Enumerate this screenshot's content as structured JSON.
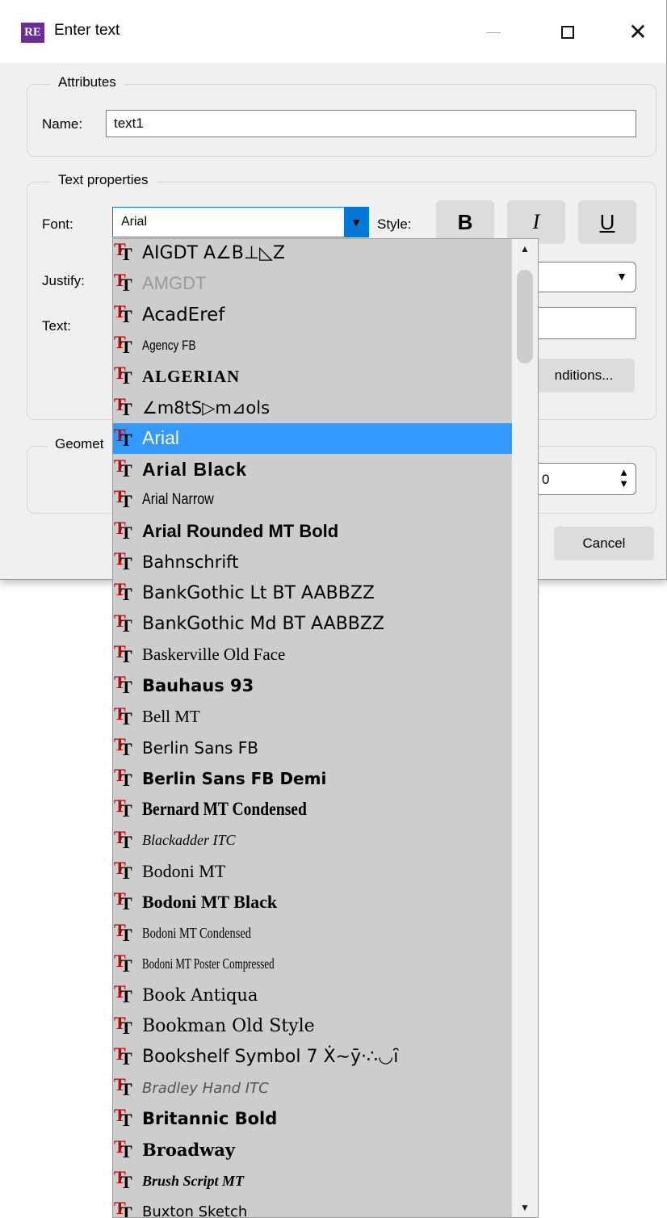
{
  "window": {
    "app_icon_text": "RE",
    "title": "Enter text",
    "close_glyph": "✕"
  },
  "attributes": {
    "group_title": "Attributes",
    "name_label": "Name:",
    "name_value": "text1"
  },
  "text_properties": {
    "group_title": "Text properties",
    "font_label": "Font:",
    "font_value": "Arial",
    "style_label": "Style:",
    "bold_label": "B",
    "italic_label": "I",
    "underline_label": "U",
    "justify_label": "Justify:",
    "text_label": "Text:",
    "conditions_button_visible": "nditions...",
    "arrow_down": "▼"
  },
  "geometry": {
    "group_title_visible": "Geomet",
    "spin_value_visible": "0"
  },
  "buttons": {
    "cancel": "Cancel"
  },
  "font_list": {
    "selected": "Arial",
    "items": [
      "AIGDT  A∠B⊥◺Z",
      "AMGDT",
      "AcadEref",
      "Agency FB",
      "ALGERIAN",
      "∠m8tS▷m⊿ols",
      "Arial",
      "Arial Black",
      "Arial Narrow",
      "Arial Rounded MT Bold",
      "Bahnschrift",
      "BankGothic Lt BT  AABBZZ",
      "BankGothic Md BT  AABBZZ",
      "Baskerville Old Face",
      "Bauhaus 93",
      "Bell MT",
      "Berlin Sans FB",
      "Berlin Sans FB Demi",
      "Bernard MT Condensed",
      "Blackadder ITC",
      "Bodoni MT",
      "Bodoni MT Black",
      "Bodoni MT Condensed",
      "Bodoni MT Poster Compressed",
      "Book Antiqua",
      "Bookman Old Style",
      "Bookshelf Symbol 7  Ẋ∼ȳ·∴◡ȋ",
      "Bradley Hand ITC",
      "Britannic Bold",
      "Broadway",
      "Brush Script MT",
      "Buxton Sketch"
    ]
  },
  "colors": {
    "accent": "#0078d7",
    "selection": "#3399ff",
    "list_bg": "#cdcdcd",
    "dialog_bg": "#f0f0f0",
    "app_icon": "#6a2d91",
    "tt_icon_red": "#cc0000"
  },
  "icons": {
    "app": "app-logo-icon",
    "minimize": "minimize-icon",
    "maximize": "maximize-icon",
    "close": "close-icon",
    "font_item": "truetype-font-icon",
    "scroll_up": "scroll-up-icon",
    "scroll_down": "scroll-down-icon"
  }
}
